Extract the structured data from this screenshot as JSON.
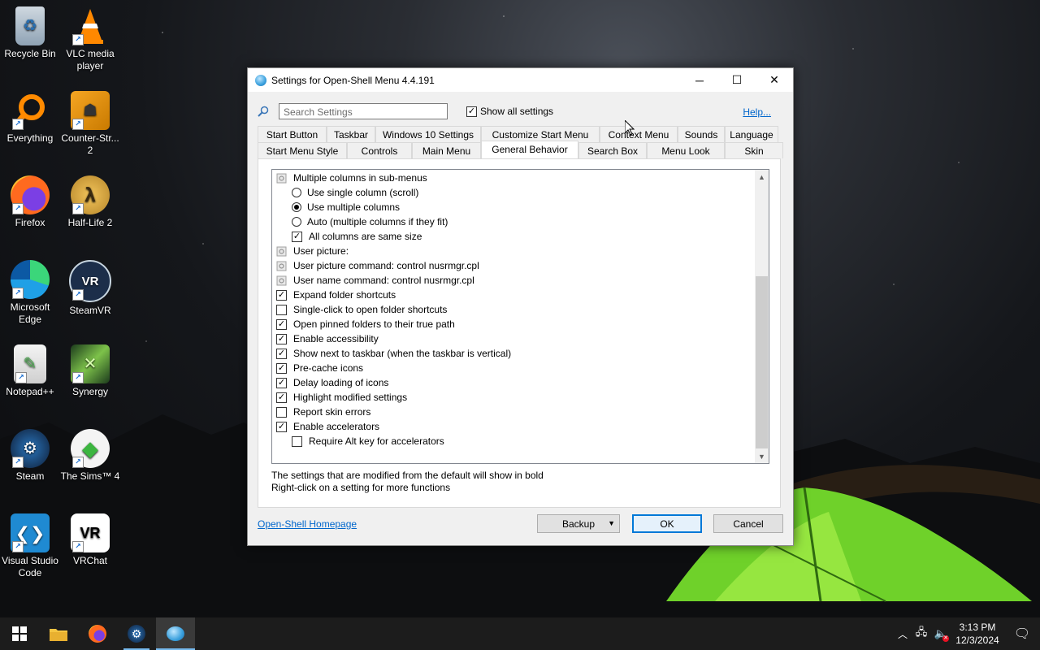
{
  "desktop": {
    "icons": [
      {
        "label": "Recycle Bin"
      },
      {
        "label": "VLC media player"
      },
      {
        "label": "Everything"
      },
      {
        "label": "Counter-Str... 2"
      },
      {
        "label": "Firefox"
      },
      {
        "label": "Half-Life 2"
      },
      {
        "label": "Microsoft Edge"
      },
      {
        "label": "SteamVR"
      },
      {
        "label": "Notepad++"
      },
      {
        "label": "Synergy"
      },
      {
        "label": "Steam"
      },
      {
        "label": "The Sims™ 4"
      },
      {
        "label": "Visual Studio Code"
      },
      {
        "label": "VRChat"
      }
    ]
  },
  "dialog": {
    "title": "Settings for Open-Shell Menu 4.4.191",
    "search_placeholder": "Search Settings",
    "show_all_label": "Show all settings",
    "show_all_checked": true,
    "help_label": "Help...",
    "tabs_row1": [
      "Start Button",
      "Taskbar",
      "Windows 10 Settings",
      "Customize Start Menu",
      "Context Menu",
      "Sounds",
      "Language"
    ],
    "tabs_row2": [
      "Start Menu Style",
      "Controls",
      "Main Menu",
      "General Behavior",
      "Search Box",
      "Menu Look",
      "Skin"
    ],
    "active_tab": "General Behavior",
    "settings": [
      {
        "type": "group",
        "label": "Multiple columns in sub-menus"
      },
      {
        "type": "radio",
        "label": "Use single column (scroll)",
        "checked": false
      },
      {
        "type": "radio",
        "label": "Use multiple columns",
        "checked": true
      },
      {
        "type": "radio",
        "label": "Auto (multiple columns if they fit)",
        "checked": false
      },
      {
        "type": "check",
        "label": "All columns are same size",
        "checked": true,
        "indent": true
      },
      {
        "type": "group",
        "label": "User picture:"
      },
      {
        "type": "group",
        "label": "User picture command: control nusrmgr.cpl"
      },
      {
        "type": "group",
        "label": "User name command: control nusrmgr.cpl"
      },
      {
        "type": "check",
        "label": "Expand folder shortcuts",
        "checked": true
      },
      {
        "type": "check",
        "label": "Single-click to open folder shortcuts",
        "checked": false
      },
      {
        "type": "check",
        "label": "Open pinned folders to their true path",
        "checked": true
      },
      {
        "type": "check",
        "label": "Enable accessibility",
        "checked": true
      },
      {
        "type": "check",
        "label": "Show next to taskbar (when the taskbar is vertical)",
        "checked": true
      },
      {
        "type": "check",
        "label": "Pre-cache icons",
        "checked": true
      },
      {
        "type": "check",
        "label": "Delay loading of icons",
        "checked": true
      },
      {
        "type": "check",
        "label": "Highlight modified settings",
        "checked": true
      },
      {
        "type": "check",
        "label": "Report skin errors",
        "checked": false
      },
      {
        "type": "check",
        "label": "Enable accelerators",
        "checked": true
      },
      {
        "type": "check",
        "label": "Require Alt key for accelerators",
        "checked": false,
        "indent": true
      }
    ],
    "info_line1": "The settings that are modified from the default will show in bold",
    "info_line2": "Right-click on a setting for more functions",
    "homepage_label": "Open-Shell Homepage",
    "backup_label": "Backup",
    "ok_label": "OK",
    "cancel_label": "Cancel"
  },
  "taskbar": {
    "time": "3:13 PM",
    "date": "12/3/2024"
  },
  "colors": {
    "accent": "#0078d7",
    "link": "#0066cc",
    "taskbar": "#1c1c1c"
  }
}
